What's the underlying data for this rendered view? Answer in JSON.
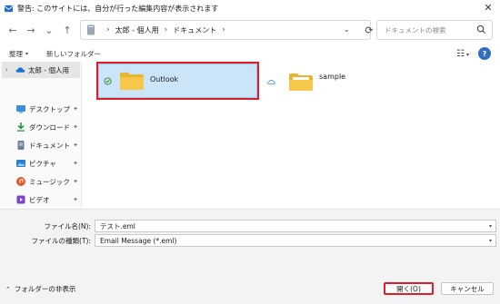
{
  "window": {
    "title": "警告: このサイトには、自分が行った編集内容が表示されます",
    "close_glyph": "✕"
  },
  "nav": {
    "back_glyph": "←",
    "forward_glyph": "→",
    "recent_glyph": "⌄",
    "up_glyph": "↑",
    "breadcrumbs": [
      "太郎 - 個人用",
      "ドキュメント"
    ],
    "sep_glyph": "›",
    "refresh_glyph": "⟳",
    "search_placeholder": "ドキュメントの検索"
  },
  "toolbar": {
    "organize_label": "整理",
    "new_folder_label": "新しいフォルダー",
    "caret_glyph": "▾",
    "view_glyph": "☷",
    "help_glyph": "?"
  },
  "sidebar": {
    "top_item": "太郎 - 個人用",
    "chev_glyph": "›",
    "pin_glyph": "📌",
    "items": [
      {
        "label": "デスクトップ",
        "icon": "desktop-icon",
        "color": "#3a8fd8"
      },
      {
        "label": "ダウンロード",
        "icon": "download-icon",
        "color": "#1f8a3b"
      },
      {
        "label": "ドキュメント",
        "icon": "document-icon",
        "color": "#6f7f94"
      },
      {
        "label": "ピクチャ",
        "icon": "pictures-icon",
        "color": "#2f7fd0"
      },
      {
        "label": "ミュージック",
        "icon": "music-icon",
        "color": "#e2572e"
      },
      {
        "label": "ビデオ",
        "icon": "video-icon",
        "color": "#7d44c9"
      }
    ]
  },
  "files": [
    {
      "name": "Outlook",
      "selected": true
    },
    {
      "name": "sample",
      "selected": false
    }
  ],
  "bottom": {
    "filename_label": "ファイル名(N):",
    "filename_value": "テスト.eml",
    "filetype_label": "ファイルの種類(T):",
    "filetype_value": "Email Message (*.eml)",
    "hide_folders_label": "フォルダーの非表示",
    "hide_caret_glyph": "⌃",
    "open_label": "開く(O)",
    "cancel_label": "キャンセル"
  },
  "colors": {
    "highlight": "#e01c2a",
    "selection": "#cce4f7",
    "folder": "#f5c84b"
  }
}
